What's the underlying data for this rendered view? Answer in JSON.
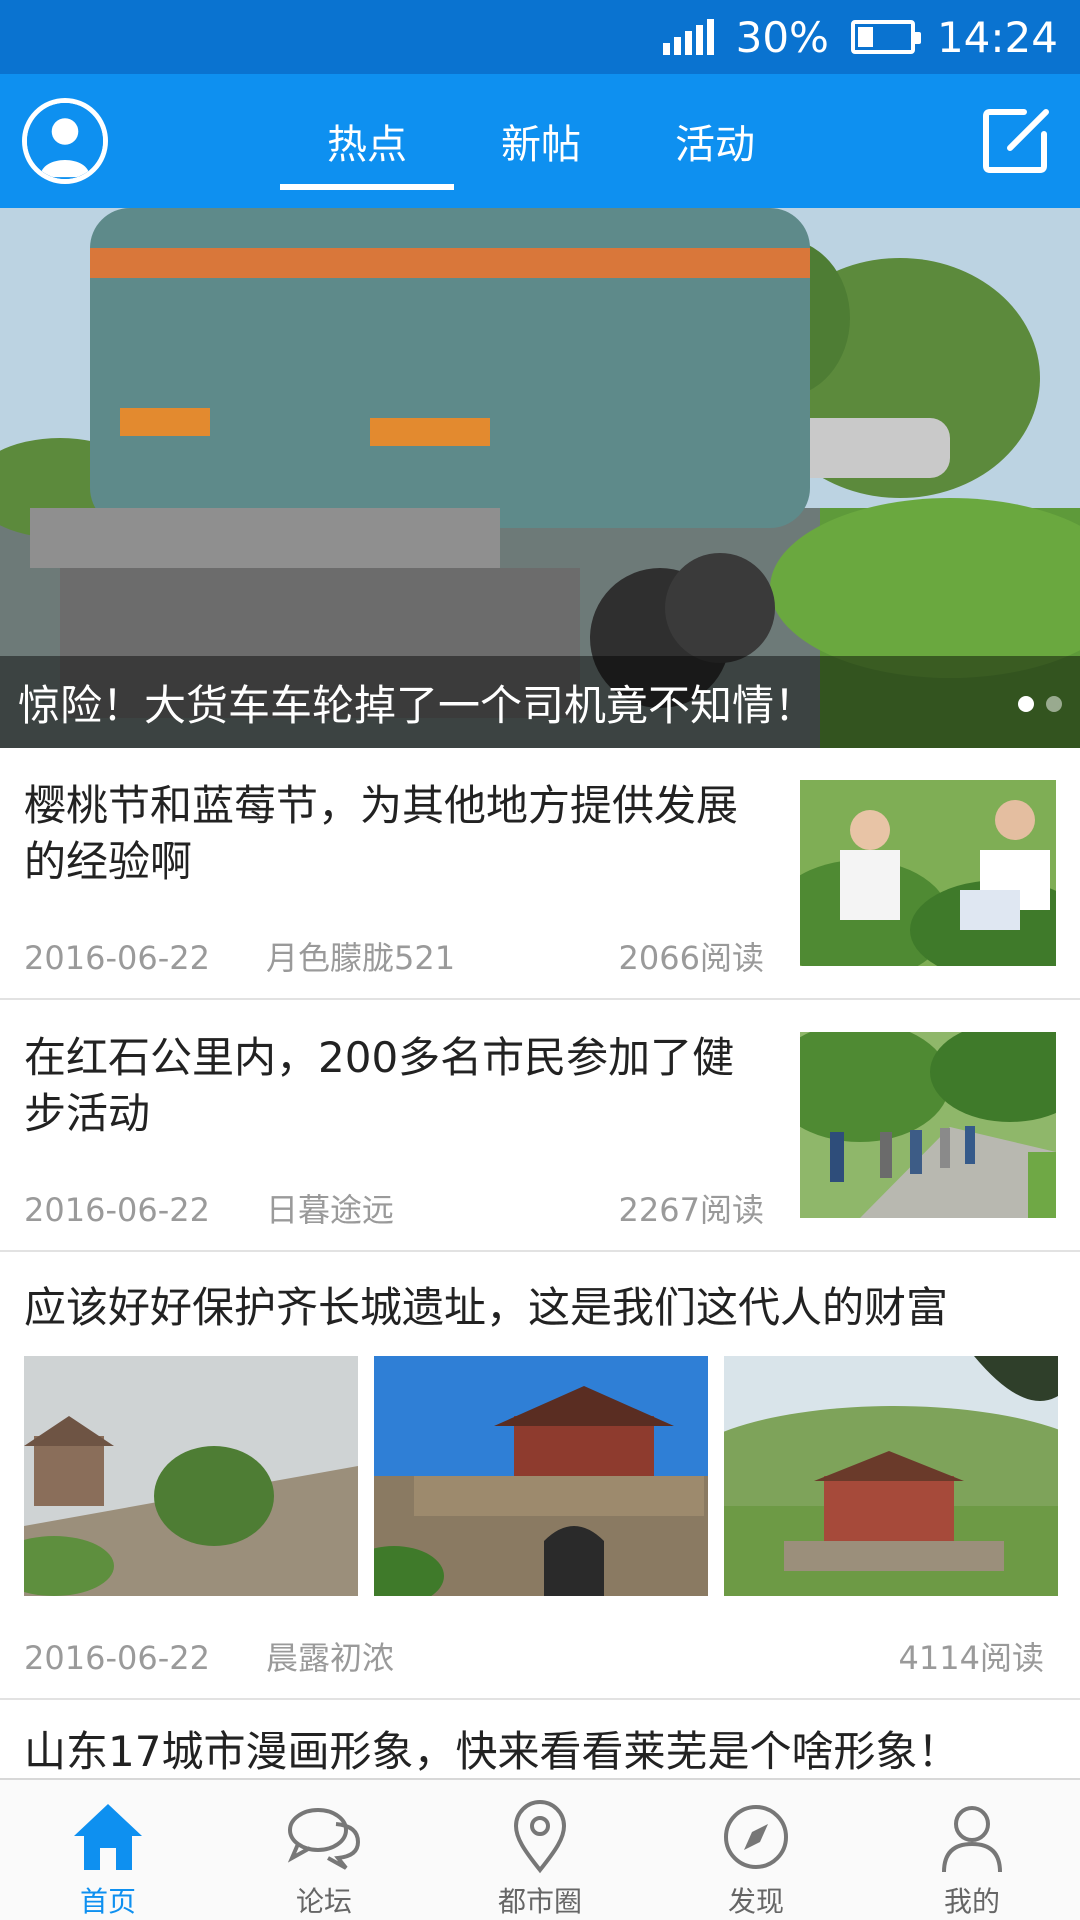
{
  "status_bar": {
    "battery_percent": "30%",
    "battery_level": 0.3,
    "time": "14:24",
    "signal_icon": "signal-bars-icon",
    "battery_icon": "battery-icon"
  },
  "header": {
    "avatar_icon": "user-avatar-icon",
    "tabs": [
      {
        "label": "热点",
        "active": true
      },
      {
        "label": "新帖",
        "active": false
      },
      {
        "label": "活动",
        "active": false
      }
    ],
    "compose_icon": "compose-icon"
  },
  "hero": {
    "caption": "惊险！大货车车轮掉了一个司机竟不知情！",
    "slide_count": 2,
    "active_slide": 1
  },
  "posts": [
    {
      "title": "樱桃节和蓝莓节，为其他地方提供发展的经验啊",
      "date": "2016-06-22",
      "author": "月色朦胧521",
      "reads": "2066阅读"
    },
    {
      "title": "在红石公里内，200多名市民参加了健步活动",
      "date": "2016-06-22",
      "author": "日暮途远",
      "reads": "2267阅读"
    },
    {
      "title": "应该好好保护齐长城遗址，这是我们这代人的财富",
      "date": "2016-06-22",
      "author": "晨露初浓",
      "reads": "4114阅读"
    },
    {
      "title": "山东17城市漫画形象，快来看看莱芜是个啥形象！"
    }
  ],
  "bottom_nav": [
    {
      "label": "首页",
      "icon": "home-icon",
      "active": true
    },
    {
      "label": "论坛",
      "icon": "chat-bubbles-icon",
      "active": false
    },
    {
      "label": "都市圈",
      "icon": "location-pin-icon",
      "active": false
    },
    {
      "label": "发现",
      "icon": "compass-icon",
      "active": false
    },
    {
      "label": "我的",
      "icon": "user-profile-icon",
      "active": false
    }
  ],
  "colors": {
    "status_bar": "#0a73d0",
    "header": "#0e90f0",
    "accent": "#0e90f0",
    "meta_text": "#9a9a9a"
  }
}
